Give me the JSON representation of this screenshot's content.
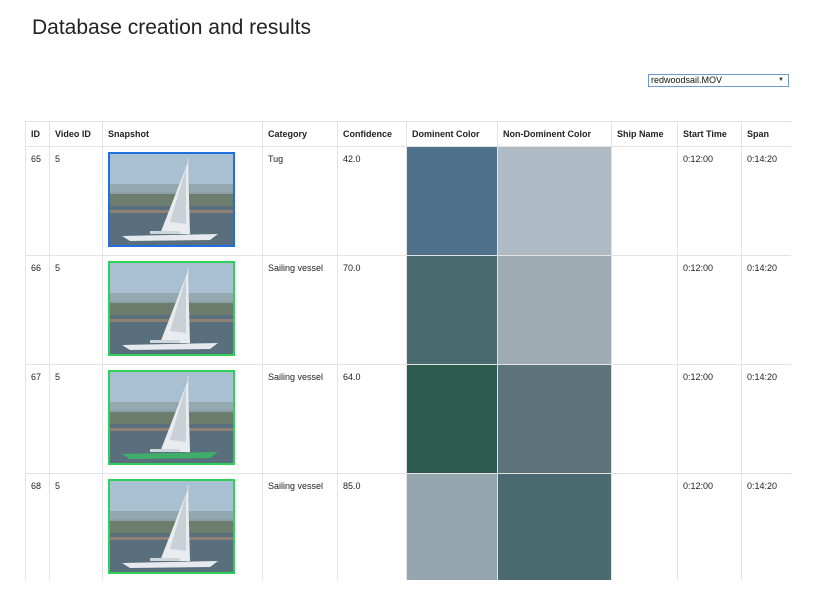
{
  "page": {
    "title": "Database creation and results"
  },
  "video_select": {
    "value": "redwoodsail.MOV"
  },
  "table": {
    "headers": {
      "id": "ID",
      "video_id": "Video ID",
      "snapshot": "Snapshot",
      "category": "Category",
      "confidence": "Confidence",
      "dominant_color": "Dominent Color",
      "non_dominant_color": "Non-Dominent Color",
      "ship_name": "Ship Name",
      "start_time": "Start Time",
      "span": "Span"
    },
    "rows": [
      {
        "id": "65",
        "video_id": "5",
        "category": "Tug",
        "confidence": "42.0",
        "dominant_color": "#50718c",
        "non_dominant_color": "#aebbc4",
        "ship_name": "",
        "start_time": "0:12:00",
        "span": "0:14:20"
      },
      {
        "id": "66",
        "video_id": "5",
        "category": "Sailing vessel",
        "confidence": "70.0",
        "dominant_color": "#496b70",
        "non_dominant_color": "#9eabb2",
        "ship_name": "",
        "start_time": "0:12:00",
        "span": "0:14:20"
      },
      {
        "id": "67",
        "video_id": "5",
        "category": "Sailing vessel",
        "confidence": "64.0",
        "dominant_color": "#2b5a4e",
        "non_dominant_color": "#5e727a",
        "ship_name": "",
        "start_time": "0:12:00",
        "span": "0:14:20"
      },
      {
        "id": "68",
        "video_id": "5",
        "category": "Sailing vessel",
        "confidence": "85.0",
        "dominant_color": "#95a6af",
        "non_dominant_color": "#4a6a70",
        "ship_name": "",
        "start_time": "0:12:00",
        "span": "0:14:20"
      }
    ]
  },
  "colors": {
    "selected_border": "#1f6fe0",
    "detection_border": "#2fd05a"
  }
}
